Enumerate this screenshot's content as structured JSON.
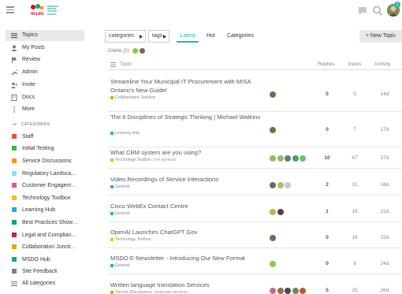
{
  "header": {
    "logo_text": "msdo",
    "logo_tagline": "MUNICIPAL SERVICE DELIVERY OFFICIAL",
    "notification_count": "1",
    "icons": [
      "hamburger-icon",
      "chat-icon",
      "search-icon",
      "user-avatar"
    ]
  },
  "sidebar": {
    "items": [
      {
        "label": "Topics",
        "icon": "topics-icon"
      },
      {
        "label": "My Posts",
        "icon": "user-icon"
      },
      {
        "label": "Review",
        "icon": "flag-icon"
      },
      {
        "label": "Admin",
        "icon": "wrench-icon"
      },
      {
        "label": "Invite",
        "icon": "invite-icon"
      },
      {
        "label": "Docs",
        "icon": "book-icon"
      },
      {
        "label": "More",
        "icon": "more-icon"
      }
    ],
    "categories_heading": "CATEGORIES",
    "categories": [
      {
        "label": "Staff",
        "color": "#e45735"
      },
      {
        "label": "Initial Testing",
        "color": "#3ab54a"
      },
      {
        "label": "Service Discussions",
        "color": "#f7941d"
      },
      {
        "label": "Regulatory Landsca…",
        "color": "#92dbef"
      },
      {
        "label": "Customer Engagem…",
        "color": "#e0539a"
      },
      {
        "label": "Technology Toolbox",
        "color": "#f1bd2a"
      },
      {
        "label": "Learning Hub",
        "color": "#25aae1"
      },
      {
        "label": "Best Practices Show…",
        "color": "#1a9c8c"
      },
      {
        "label": "Legal and Complian…",
        "color": "#d11a4f"
      },
      {
        "label": "Collaboration Juncti…",
        "color": "#f0a020"
      },
      {
        "label": "MSDO Hub",
        "color": "#12a89d"
      },
      {
        "label": "Site Feedback",
        "color": "#808281"
      }
    ],
    "all_categories": "All categories"
  },
  "nav": {
    "categories_dropdown": "categories",
    "tags_dropdown": "tags",
    "tabs": [
      "Latest",
      "Hot",
      "Categories"
    ],
    "active_tab": "Latest",
    "new_topic": "+ New Topic"
  },
  "online": "Online (2):",
  "table": {
    "headers": {
      "topic": "Topic",
      "replies": "Replies",
      "views": "Views",
      "activity": "Activity"
    },
    "rows": [
      {
        "title": "Streamline Your Municipal IT Procurement with MISA Ontario's New Guide!",
        "category": "Collaboration Junction",
        "category_color": "#f0a020",
        "tags": "",
        "replies": "0",
        "views": "5",
        "activity": "14d",
        "posters": [
          "#7a6a4a"
        ]
      },
      {
        "title": "The 6 Disciplines of Strategic Thinking | Michael Watkins",
        "category": "Learning Hub",
        "category_color": "#25aae1",
        "tags": "",
        "replies": "0",
        "views": "7",
        "activity": "17d",
        "posters": [
          "#7a6a4a"
        ]
      },
      {
        "title": "What CRM system are you using?",
        "category": "Technology Toolbox",
        "category_color": "#f1bd2a",
        "tags": "crm-systems",
        "replies": "10",
        "views": "67",
        "activity": "17d",
        "posters": [
          "#9ab86a",
          "#9bb86d",
          "#5c7a7a",
          "#4aa06a",
          "#6ac46a"
        ]
      },
      {
        "title": "Video Recordings of Service Interactions",
        "category": "General",
        "category_color": "#25aae1",
        "tags": "",
        "replies": "2",
        "views": "31",
        "activity": "18d",
        "posters": [
          "#6a6a6a",
          "#9ac85a",
          "#c8c8c8"
        ]
      },
      {
        "title": "Cisco WebEx Contact Centre",
        "category": "General",
        "category_color": "#25aae1",
        "tags": "",
        "replies": "1",
        "views": "18",
        "activity": "21d",
        "posters": [
          "#b8b84a",
          "#5a3a3a"
        ]
      },
      {
        "title": "OpenAI Launches ChatGPT Gov",
        "category": "Technology Toolbox",
        "category_color": "#f1bd2a",
        "tags": "",
        "replies": "0",
        "views": "16",
        "activity": "22d",
        "posters": [
          "#7a6a4a"
        ]
      },
      {
        "title": "MSDO E-Newsletter - Introducing Our New Format",
        "category": "General",
        "category_color": "#25aae1",
        "tags": "",
        "replies": "0",
        "views": "8",
        "activity": "24d",
        "posters": [
          "#8ac84a"
        ]
      },
      {
        "title": "Written language translation Services",
        "category": "Service Discussions",
        "category_color": "#f7941d",
        "tags": "corporate-services",
        "replies": "5",
        "views": "25",
        "activity": "26d",
        "posters": [
          "#c86a8a",
          "#9a6a4a",
          "#4a4a4a",
          "#6a8a4a",
          "#b85a3a"
        ]
      }
    ]
  }
}
